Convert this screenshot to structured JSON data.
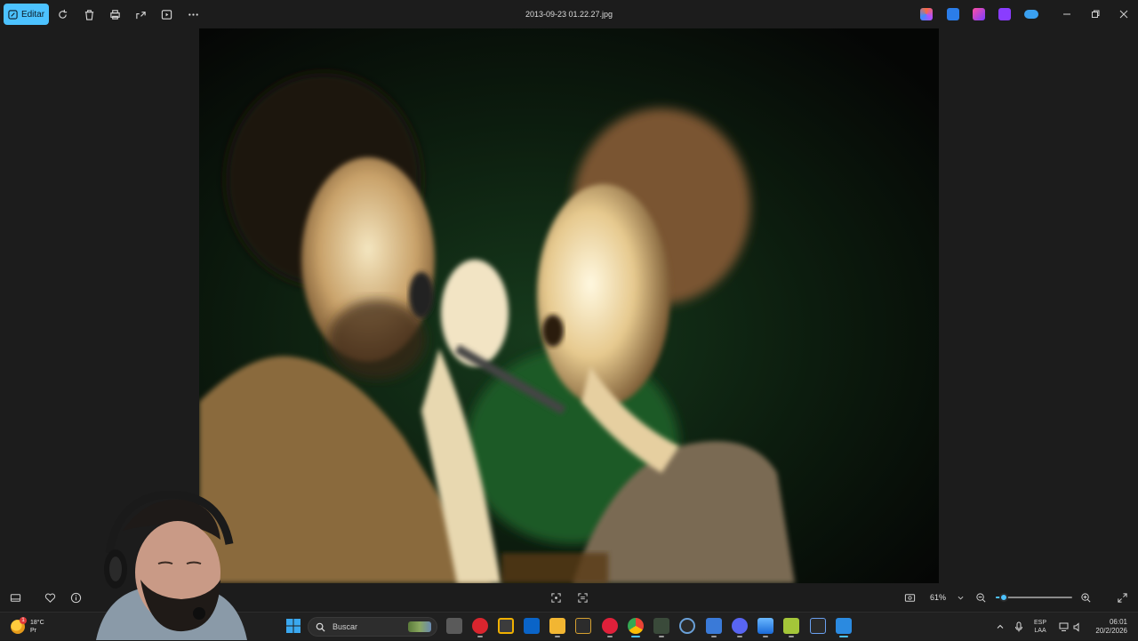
{
  "toolbar": {
    "edit_label": "Editar",
    "filename": "2013-09-23 01.22.27.jpg"
  },
  "viewer": {
    "zoom_label": "61%",
    "zoom_fraction": 0.1
  },
  "taskbar": {
    "weather_temp": "18°C",
    "weather_desc": "Pr",
    "weather_badge": "1",
    "search_placeholder": "Buscar",
    "lang_primary": "ESP",
    "lang_secondary": "LAA",
    "time": "06:01",
    "date": "20/2/2026"
  },
  "colors": {
    "accent": "#4cc2ff",
    "background": "#1c1c1c",
    "taskbar": "#202020"
  }
}
